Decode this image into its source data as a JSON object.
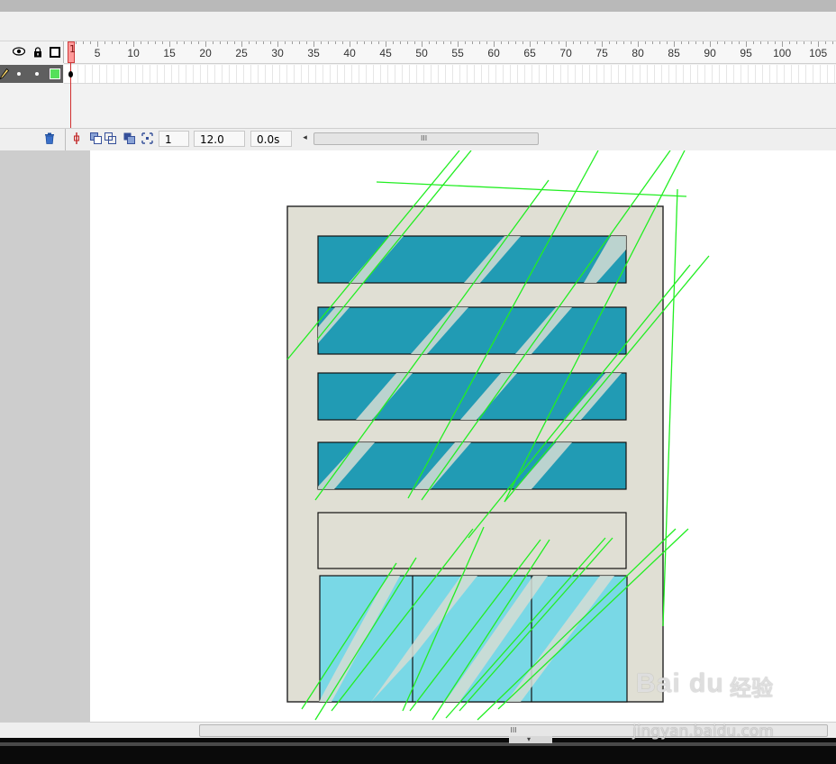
{
  "timeline": {
    "frame_numbers": [
      "1",
      "5",
      "10",
      "15",
      "20",
      "25",
      "30",
      "35",
      "40",
      "45",
      "50",
      "55",
      "60",
      "65",
      "70",
      "75",
      "80",
      "85",
      "90",
      "95",
      "100",
      "105"
    ],
    "current_frame": "1",
    "fps": "12.0 fps",
    "elapsed_time": "0.0s",
    "scroll_grip": "III"
  },
  "bottom_scroll": {
    "grip": "III"
  },
  "watermark": {
    "brand": "Bai du",
    "brand_cn": "经验",
    "url": "jingyan.baidu.com"
  },
  "colors": {
    "building_body": "#e0dfd4",
    "window_band": "#219bb4",
    "storefront": "#79d8e6",
    "guide_line": "#22ee22"
  },
  "icons": [
    "eye-icon",
    "lock-icon",
    "outline-icon",
    "pencil-icon",
    "layer-color-icon",
    "trash-icon",
    "onion-skin-icon",
    "onion-outline-icon",
    "edit-multiple-icon",
    "modify-markers-icon"
  ]
}
